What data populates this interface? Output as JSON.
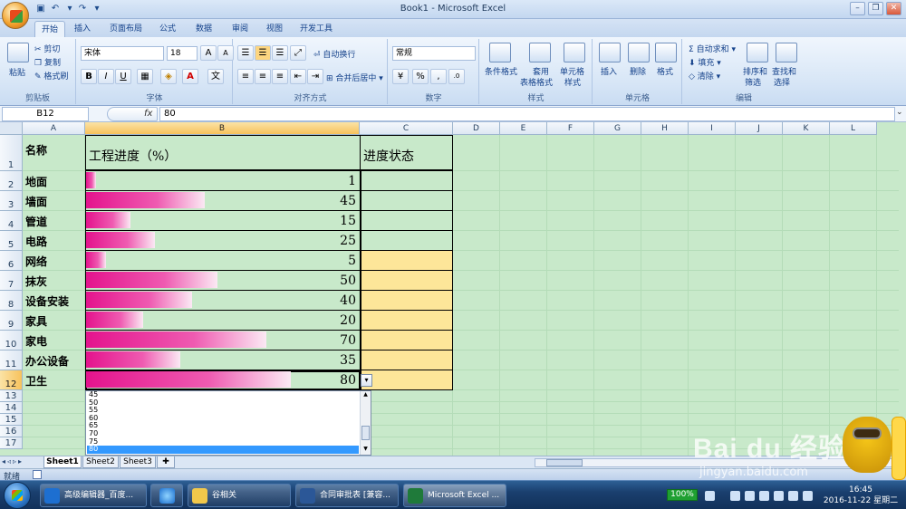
{
  "window": {
    "title": "Book1 - Microsoft Excel"
  },
  "tabs": [
    "开始",
    "插入",
    "页面布局",
    "公式",
    "数据",
    "审阅",
    "视图",
    "开发工具"
  ],
  "ribbon": {
    "clipboard": {
      "paste": "粘贴",
      "cut": "剪切",
      "copy": "复制",
      "format_painter": "格式刷",
      "label": "剪贴板"
    },
    "font": {
      "name": "宋体",
      "size": "18",
      "label": "字体",
      "bold": "B",
      "italic": "I",
      "underline": "U",
      "grow": "A",
      "shrink": "A"
    },
    "alignment": {
      "wrap": "自动换行",
      "merge": "合并后居中",
      "label": "对齐方式"
    },
    "number": {
      "format": "常规",
      "percent": "%",
      "comma": ",",
      "label": "数字"
    },
    "styles": {
      "conditional": "条件格式",
      "table_line1": "套用",
      "table_line2": "表格格式",
      "cell_line1": "单元格",
      "cell_line2": "样式",
      "label": "样式"
    },
    "cells": {
      "insert": "插入",
      "delete": "删除",
      "format": "格式",
      "label": "单元格"
    },
    "editing": {
      "autosum": "自动求和",
      "fill": "填充",
      "clear": "清除",
      "sort_line1": "排序和",
      "sort_line2": "筛选",
      "find_line1": "查找和",
      "find_line2": "选择",
      "label": "编辑"
    }
  },
  "formula_bar": {
    "name_box": "B12",
    "fx": "fx",
    "value": "80"
  },
  "columns": [
    "A",
    "B",
    "C",
    "D",
    "E",
    "F",
    "G",
    "H",
    "I",
    "J",
    "K",
    "L"
  ],
  "rows": [
    "1",
    "2",
    "3",
    "4",
    "5",
    "6",
    "7",
    "8",
    "9",
    "10",
    "11",
    "12",
    "13",
    "14",
    "15",
    "16",
    "17"
  ],
  "header_row": {
    "a": "名称",
    "b": "工程进度（%）",
    "c": "进度状态"
  },
  "items": [
    {
      "name": "地面",
      "value": 1
    },
    {
      "name": "墙面",
      "value": 45
    },
    {
      "name": "管道",
      "value": 15
    },
    {
      "name": "电路",
      "value": 25
    },
    {
      "name": "网络",
      "value": 5
    },
    {
      "name": "抹灰",
      "value": 50
    },
    {
      "name": "设备安装",
      "value": 40
    },
    {
      "name": "家具",
      "value": 20
    },
    {
      "name": "家电",
      "value": 70
    },
    {
      "name": "办公设备",
      "value": 35
    },
    {
      "name": "卫生",
      "value": 80
    }
  ],
  "status_highlight_color": "#fde699",
  "dropdown": {
    "options": [
      "45",
      "50",
      "55",
      "60",
      "65",
      "70",
      "75",
      "80"
    ],
    "selected": "80"
  },
  "sheets": [
    "Sheet1",
    "Sheet2",
    "Sheet3"
  ],
  "status": {
    "ready": "就绪"
  },
  "taskbar": {
    "items": [
      "高级编辑器_百度...",
      "",
      "谷相关",
      "合同审批表 [兼容...",
      "Microsoft Excel ..."
    ],
    "battery": "100%",
    "time": "16:45",
    "date": "2016-11-22 星期二"
  },
  "watermark": {
    "logo": "Bai du 经验",
    "url": "jingyan.baidu.com"
  }
}
